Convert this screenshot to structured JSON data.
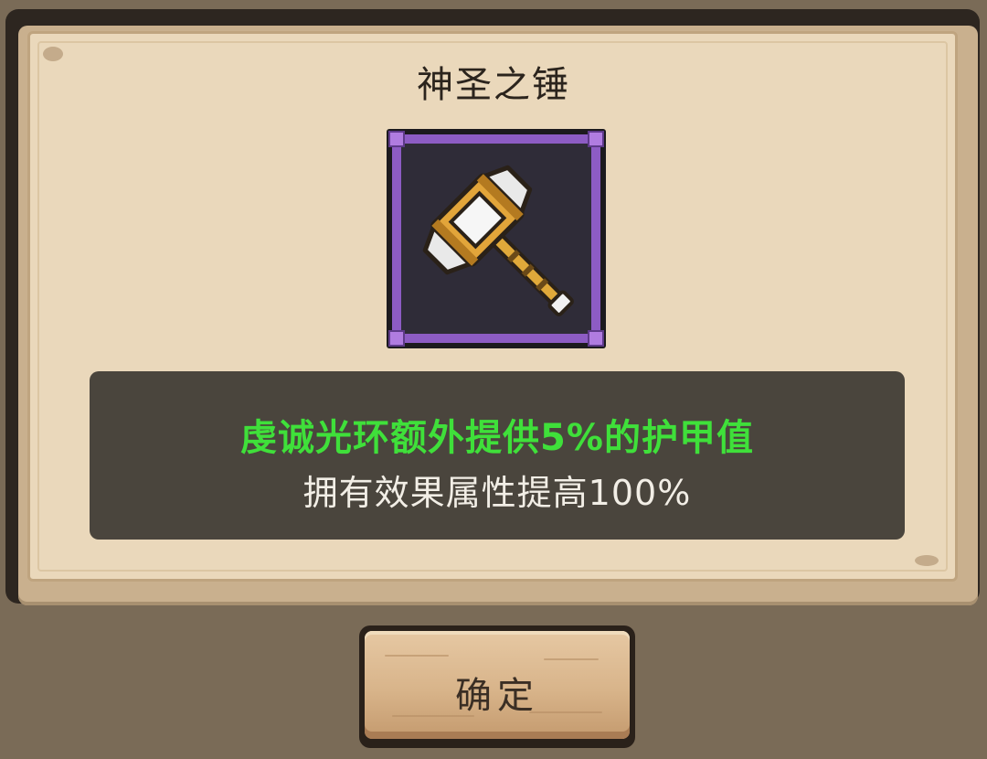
{
  "dialog": {
    "title": "神圣之锤",
    "item_icon": "holy-hammer-icon",
    "effect_text": "虔诚光环额外提供5%的护甲值",
    "bonus_text": "拥有效果属性提高100%",
    "confirm_label": "确定"
  },
  "colors": {
    "effect_text": "#3fe03a",
    "rarity_border": "#8d5cc4",
    "panel_bg": "#ead8bb",
    "desc_bg": "#4a453d"
  }
}
